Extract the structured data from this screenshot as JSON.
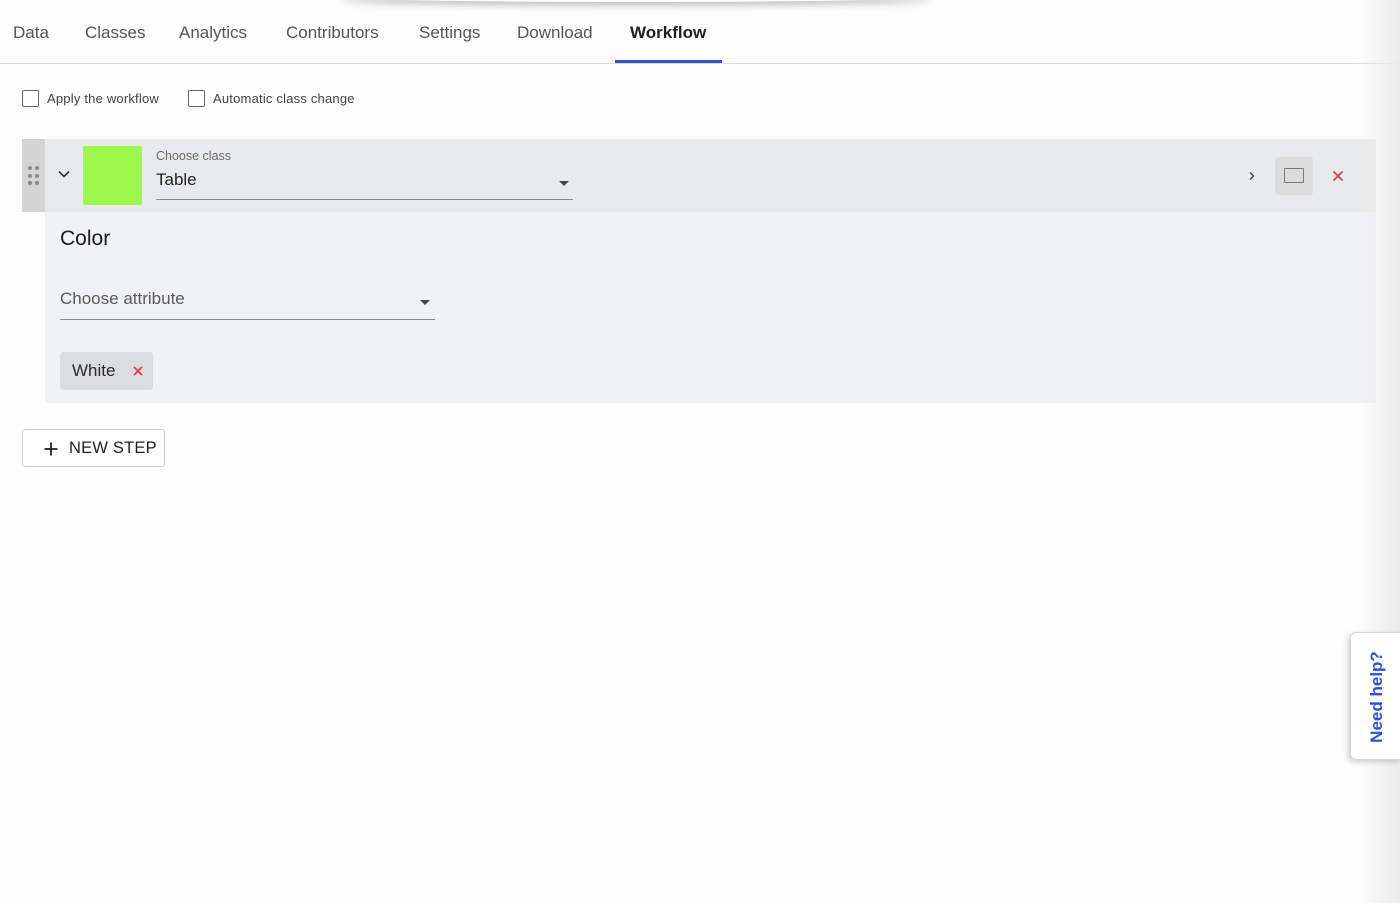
{
  "tabs": [
    {
      "label": "Data"
    },
    {
      "label": "Classes"
    },
    {
      "label": "Analytics"
    },
    {
      "label": "Contributors"
    },
    {
      "label": "Settings"
    },
    {
      "label": "Download"
    },
    {
      "label": "Workflow"
    }
  ],
  "active_tab": "Workflow",
  "options": {
    "apply_workflow": {
      "label": "Apply the workflow",
      "checked": false
    },
    "automatic_class_change": {
      "label": "Automatic class change",
      "checked": false
    }
  },
  "step": {
    "class_caption": "Choose class",
    "class_value": "Table",
    "class_color": "#9df84e",
    "section_title": "Color",
    "attribute_placeholder": "Choose attribute",
    "chips": [
      {
        "label": "White"
      }
    ]
  },
  "new_step_label": "NEW STEP",
  "help_label": "Need help?",
  "colors": {
    "accent": "#3550d6",
    "danger": "#e0354a",
    "help_text": "#2f4fd8"
  },
  "icons": [
    "drag-handle-icon",
    "chevron-down-icon",
    "chevron-right-icon",
    "frame-icon",
    "close-icon",
    "plus-icon"
  ]
}
